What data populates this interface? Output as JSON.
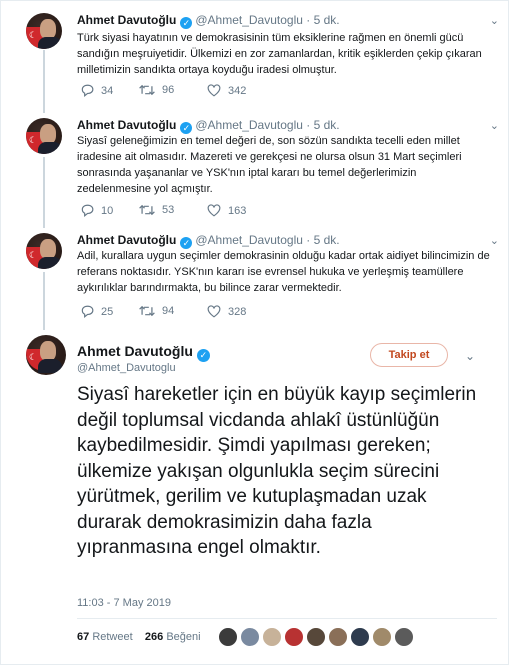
{
  "colors": {
    "accent": "#1da1f2",
    "follow": "#c2481f",
    "muted": "#657786",
    "text": "#14171a"
  },
  "tweets": [
    {
      "name": "Ahmet Davutoğlu",
      "handle": "@Ahmet_Davutoglu",
      "time": "· 5 dk.",
      "text": "Türk siyasi hayatının ve demokrasisinin tüm eksiklerine rağmen en önemli gücü sandığın meşruiyetidir. Ülkemizi en zor zamanlardan, kritik eşiklerden çekip çıkaran milletimizin sandıkta ortaya koyduğu iradesi olmuştur.",
      "replies": "34",
      "retweets": "96",
      "likes": "342"
    },
    {
      "name": "Ahmet Davutoğlu",
      "handle": "@Ahmet_Davutoglu",
      "time": "· 5 dk.",
      "text": "Siyasî geleneğimizin en temel değeri de, son sözün sandıkta tecelli eden millet iradesine ait olmasıdır. Mazereti ve gerekçesi ne olursa olsun 31 Mart seçimleri sonrasında yaşananlar ve YSK'nın iptal kararı bu temel değerlerimizin zedelenmesine yol açmıştır.",
      "replies": "10",
      "retweets": "53",
      "likes": "163"
    },
    {
      "name": "Ahmet Davutoğlu",
      "handle": "@Ahmet_Davutoglu",
      "time": "· 5 dk.",
      "text": "Adil, kurallara uygun seçimler demokrasinin olduğu kadar ortak aidiyet bilincimizin de referans noktasıdır. YSK'nın kararı ise evrensel hukuka ve yerleşmiş teamüllere aykırılıklar barındırmakta, bu bilince zarar vermektedir.",
      "replies": "25",
      "retweets": "94",
      "likes": "328"
    }
  ],
  "main": {
    "name": "Ahmet Davutoğlu",
    "handle": "@Ahmet_Davutoglu",
    "follow_label": "Takip et",
    "text": "Siyasî hareketler için en büyük kayıp seçimlerin değil toplumsal vicdanda ahlakî üstünlüğün kaybedilmesidir. Şimdi yapılması gereken; ülkemize yakışan olgunlukla seçim sürecini yürütmek, gerilim ve kutuplaşmadan uzak durarak demokrasimizin daha fazla yıpranmasına engel olmaktır.",
    "timestamp": "11:03 - 7 May 2019",
    "retweet_count": "67",
    "retweet_label": "Retweet",
    "like_count": "266",
    "like_label": "Beğeni"
  },
  "icons": {
    "verified": "verified-badge-icon",
    "reply": "reply-icon",
    "retweet": "retweet-icon",
    "like": "heart-icon",
    "more": "chevron-down-icon"
  },
  "likers": [
    "#3b3b3b",
    "#7a8aa0",
    "#c7b299",
    "#b83232",
    "#57483a",
    "#8a6f58",
    "#2e3b4e",
    "#a08a6a",
    "#5b5b5b"
  ]
}
